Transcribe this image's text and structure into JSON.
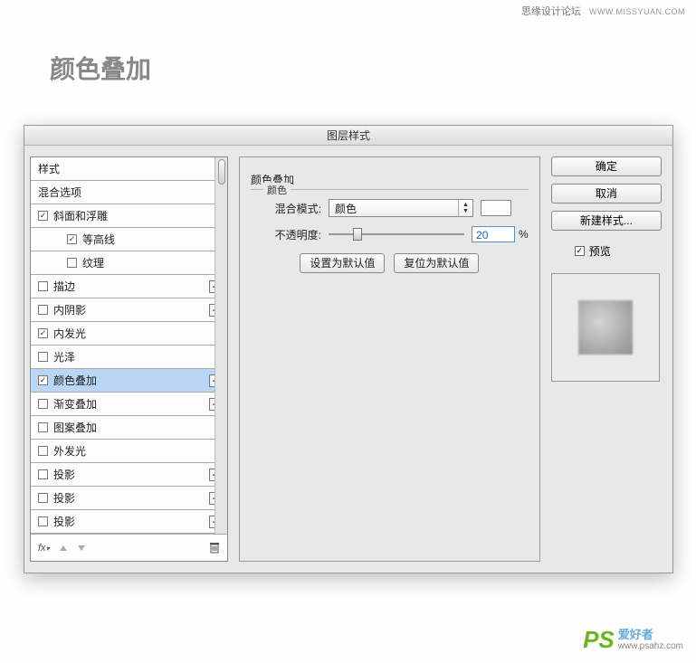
{
  "watermark_top": {
    "site": "思缘设计论坛",
    "url": "WWW.MISSYUAN.COM"
  },
  "page_title": "颜色叠加",
  "dialog_title": "图层样式",
  "styles_list": [
    {
      "label": "样式",
      "has_checkbox": false,
      "has_plus": false,
      "indent": 0
    },
    {
      "label": "混合选项",
      "has_checkbox": false,
      "has_plus": false,
      "indent": 0
    },
    {
      "label": "斜面和浮雕",
      "has_checkbox": true,
      "checked": true,
      "has_plus": false,
      "indent": 0
    },
    {
      "label": "等高线",
      "has_checkbox": true,
      "checked": true,
      "has_plus": false,
      "indent": 2
    },
    {
      "label": "纹理",
      "has_checkbox": true,
      "checked": false,
      "has_plus": false,
      "indent": 2
    },
    {
      "label": "描边",
      "has_checkbox": true,
      "checked": false,
      "has_plus": true,
      "indent": 0
    },
    {
      "label": "内阴影",
      "has_checkbox": true,
      "checked": false,
      "has_plus": true,
      "indent": 0
    },
    {
      "label": "内发光",
      "has_checkbox": true,
      "checked": true,
      "has_plus": false,
      "indent": 0
    },
    {
      "label": "光泽",
      "has_checkbox": true,
      "checked": false,
      "has_plus": false,
      "indent": 0
    },
    {
      "label": "颜色叠加",
      "has_checkbox": true,
      "checked": true,
      "has_plus": true,
      "indent": 0,
      "selected": true
    },
    {
      "label": "渐变叠加",
      "has_checkbox": true,
      "checked": false,
      "has_plus": true,
      "indent": 0
    },
    {
      "label": "图案叠加",
      "has_checkbox": true,
      "checked": false,
      "has_plus": false,
      "indent": 0
    },
    {
      "label": "外发光",
      "has_checkbox": true,
      "checked": false,
      "has_plus": false,
      "indent": 0
    },
    {
      "label": "投影",
      "has_checkbox": true,
      "checked": false,
      "has_plus": true,
      "indent": 0
    },
    {
      "label": "投影",
      "has_checkbox": true,
      "checked": false,
      "has_plus": true,
      "indent": 0
    },
    {
      "label": "投影",
      "has_checkbox": true,
      "checked": false,
      "has_plus": true,
      "indent": 0
    }
  ],
  "center": {
    "section_title": "颜色叠加",
    "subsection_title": "颜色",
    "blend_mode_label": "混合模式:",
    "blend_mode_value": "颜色",
    "opacity_label": "不透明度:",
    "opacity_value": "20",
    "opacity_suffix": "%",
    "btn_default": "设置为默认值",
    "btn_reset": "复位为默认值"
  },
  "right": {
    "ok": "确定",
    "cancel": "取消",
    "new_style": "新建样式...",
    "preview": "预览"
  },
  "footer_fx": "fx",
  "watermark_bottom": {
    "logo": "PS",
    "cn": "爱好者",
    "url": "www.psahz.com"
  }
}
